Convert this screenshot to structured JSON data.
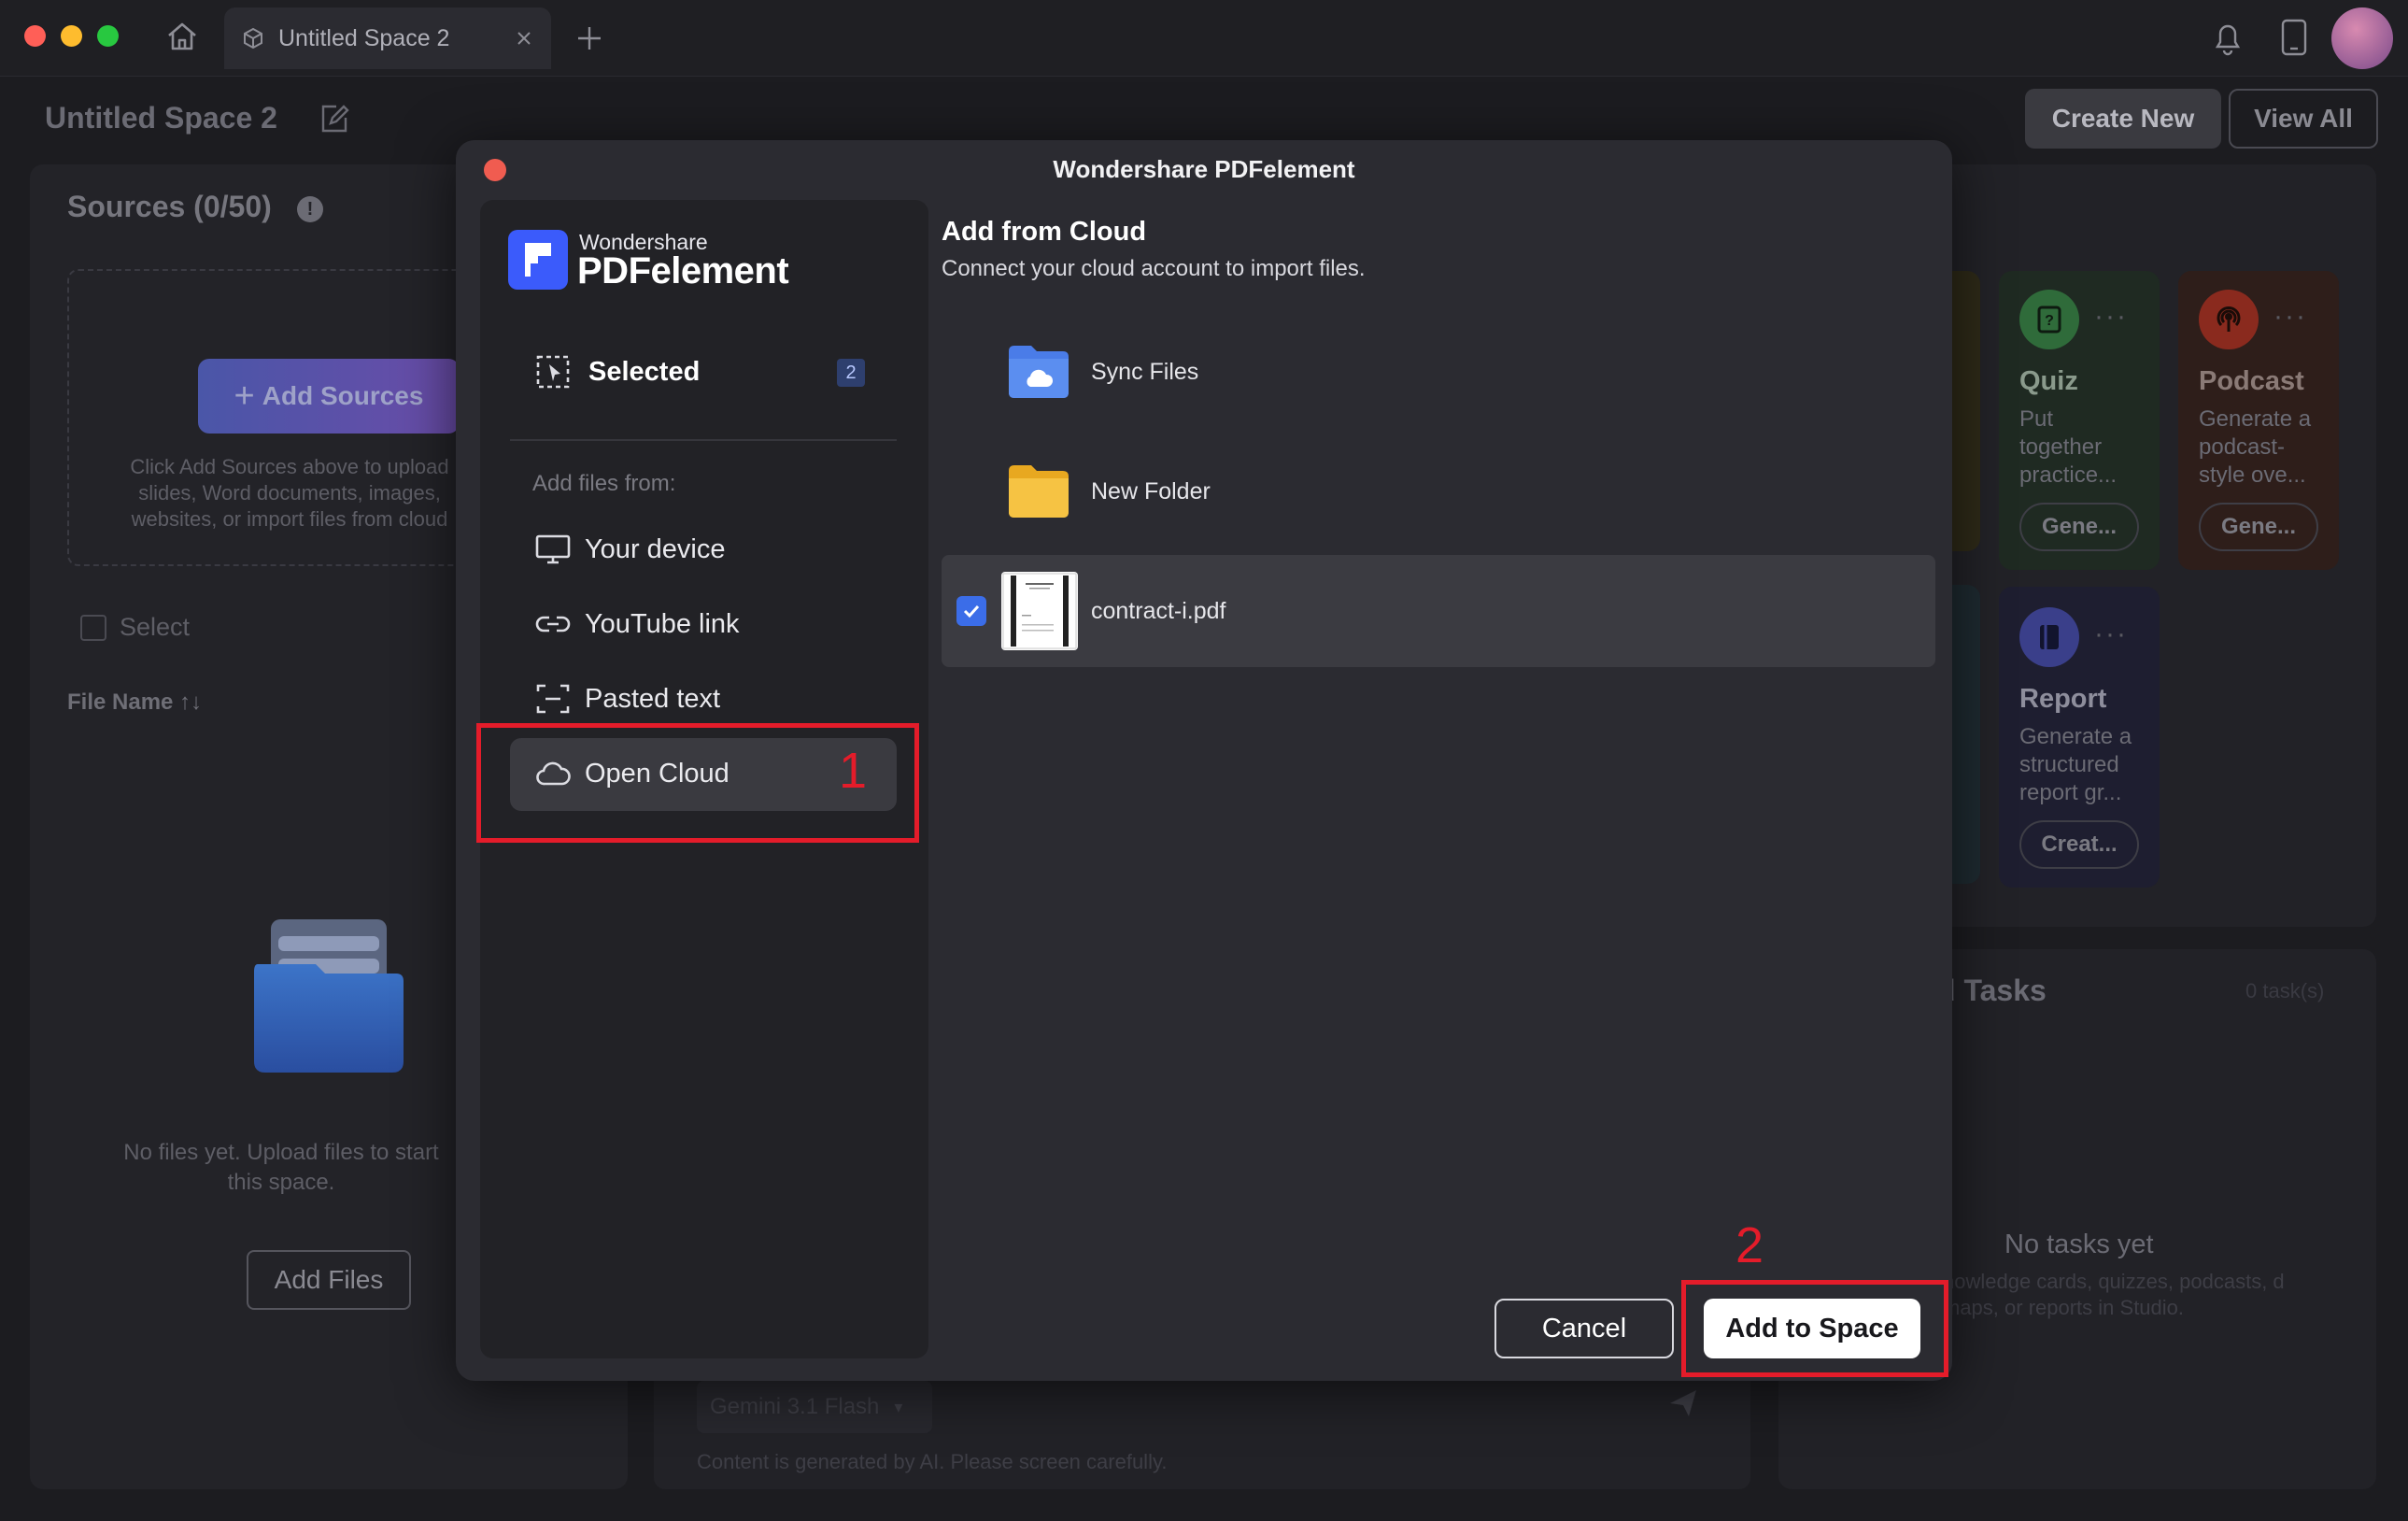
{
  "window": {
    "tab_title": "Untitled Space 2",
    "traffic_colors": [
      "#ff5f57",
      "#febc2e",
      "#28c840"
    ]
  },
  "background": {
    "space_title": "Untitled Space 2",
    "create_new": "Create New",
    "view_all": "View All",
    "sources_title": "Sources (0/50)",
    "add_sources": "Add Sources",
    "drop_help": "Click Add Sources above to upload slides, Word documents, images, websites, or import files from cloud",
    "select_label": "Select",
    "file_name_header": "File Name ↑↓",
    "no_files": "No files yet. Upload files to start this space.",
    "add_files": "Add Files",
    "model_select": "Gemini 3.1 Flash",
    "ai_note": "Content is generated by AI. Please screen carefully.",
    "studio_cards": [
      {
        "title": "Quiz",
        "desc": "Put together practice...",
        "button": "Gene...",
        "color": "#2f6b3a",
        "icon": "quiz-icon"
      },
      {
        "title": "Podcast",
        "desc": "Generate a podcast-style ove...",
        "button": "Gene...",
        "color": "#8a2a1e",
        "icon": "podcast-icon"
      },
      {
        "title": "Report",
        "desc": "Generate a structured report gr...",
        "button": "Creat...",
        "color": "#3a3f8a",
        "icon": "report-icon"
      }
    ],
    "tasks_title": "d Tasks",
    "tasks_count": "0 task(s)",
    "no_tasks": "No tasks yet",
    "no_tasks_desc": "nowledge cards, quizzes, podcasts, d maps, or reports in Studio."
  },
  "modal": {
    "title": "Wondershare PDFelement",
    "brand_top": "Wondershare",
    "brand_main": "PDFelement",
    "selected_label": "Selected",
    "selected_count": "2",
    "add_files_from": "Add files from:",
    "sources": [
      {
        "label": "Your device",
        "icon": "monitor-icon"
      },
      {
        "label": "YouTube link",
        "icon": "link-icon"
      },
      {
        "label": "Pasted text",
        "icon": "text-scan-icon"
      },
      {
        "label": "Open Cloud",
        "icon": "cloud-icon",
        "active": true
      }
    ],
    "heading": "Add from Cloud",
    "subheading": "Connect your cloud account to import files.",
    "files": [
      {
        "name": "Sync Files",
        "type": "cloud-folder"
      },
      {
        "name": "New Folder",
        "type": "folder"
      },
      {
        "name": "contract-i.pdf",
        "type": "pdf",
        "checked": true
      }
    ],
    "cancel": "Cancel",
    "add_to_space": "Add to Space"
  },
  "annotations": {
    "step1": "1",
    "step2": "2",
    "color": "#e41c2a"
  }
}
